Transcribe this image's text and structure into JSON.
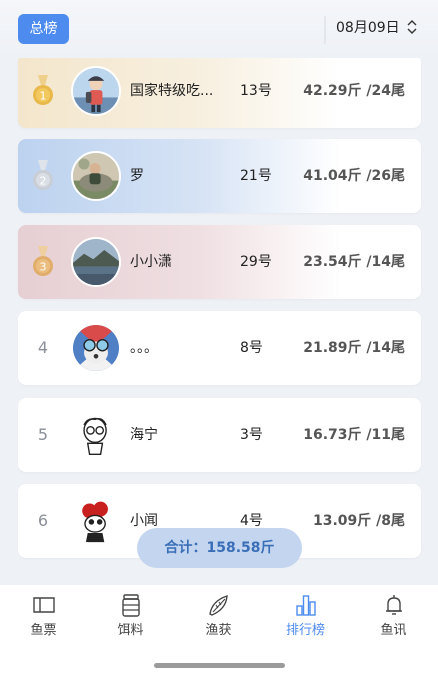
{
  "header": {
    "total_badge": "总榜",
    "date": "08月09日"
  },
  "rankings": [
    {
      "rank": "1",
      "medal": "gold",
      "name": "国家特级吃...",
      "spot": "13号",
      "weight": "42.29斤 /24尾"
    },
    {
      "rank": "2",
      "medal": "silver",
      "name": "罗",
      "spot": "21号",
      "weight": "41.04斤 /26尾"
    },
    {
      "rank": "3",
      "medal": "bronze",
      "name": "小小潇",
      "spot": "29号",
      "weight": "23.54斤 /14尾"
    },
    {
      "rank": "4",
      "medal": "",
      "name": "。。。",
      "spot": "8号",
      "weight": "21.89斤 /14尾"
    },
    {
      "rank": "5",
      "medal": "",
      "name": "海宁",
      "spot": "3号",
      "weight": "16.73斤 /11尾"
    },
    {
      "rank": "6",
      "medal": "",
      "name": "小闻",
      "spot": "4号",
      "weight": "13.09斤 /8尾"
    }
  ],
  "total": "合计：158.58斤",
  "tabs": [
    {
      "label": "鱼票",
      "icon": "ticket-icon",
      "active": false
    },
    {
      "label": "饵料",
      "icon": "bait-jar-icon",
      "active": false
    },
    {
      "label": "渔获",
      "icon": "fish-icon",
      "active": false
    },
    {
      "label": "排行榜",
      "icon": "bar-chart-icon",
      "active": true
    },
    {
      "label": "鱼讯",
      "icon": "bell-icon",
      "active": false
    }
  ],
  "colors": {
    "accent": "#4d8bee",
    "gold": "#e8b94a",
    "silver": "#c9ced6",
    "bronze": "#e0ad6a"
  }
}
